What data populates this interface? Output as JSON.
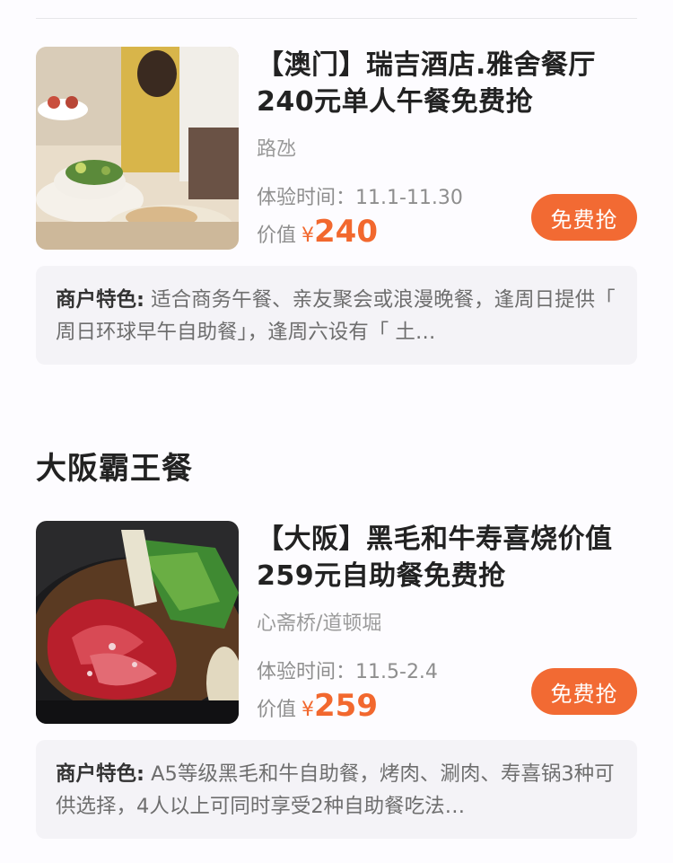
{
  "deals": [
    {
      "title": "【澳门】瑞吉酒店.雅舍餐厅240元单人午餐免费抢",
      "location": "路氹",
      "time_label": "体验时间：",
      "time_value": "11.1-11.30",
      "price_label": "价值",
      "currency": "¥",
      "price": "240",
      "button": "免费抢",
      "feature_label": "商户特色:",
      "feature_text": " 适合商务午餐、亲友聚会或浪漫晚餐，逢周日提供「 周日环球早午自助餐」，逢周六设有「 土…"
    },
    {
      "title": "【大阪】黑毛和牛寿喜烧价值259元自助餐免费抢",
      "location": "心斋桥/道顿堀",
      "time_label": "体验时间：",
      "time_value": "11.5-2.4",
      "price_label": "价值",
      "currency": "¥",
      "price": "259",
      "button": "免费抢",
      "feature_label": "商户特色:",
      "feature_text": " A5等级黑毛和牛自助餐，烤肉、涮肉、寿喜锅3种可供选择，4人以上可同时享受2种自助餐吃法…"
    }
  ],
  "section_title": "大阪霸王餐",
  "colors": {
    "accent": "#f26a33",
    "price": "#f2682e",
    "card_bg": "#f4f3f7"
  }
}
